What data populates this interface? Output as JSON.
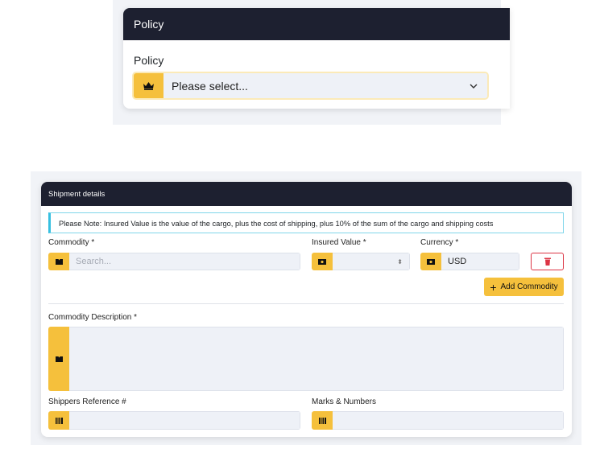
{
  "policy_panel": {
    "header": "Policy",
    "label": "Policy",
    "select_value": "Please select..."
  },
  "shipment": {
    "header": "Shipment details",
    "note": "Please Note: Insured Value is the value of the cargo, plus the cost of shipping, plus 10% of the sum of the cargo and shipping costs",
    "commodity_label": "Commodity *",
    "commodity_placeholder": "Search...",
    "insured_label": "Insured Value *",
    "currency_label": "Currency *",
    "currency_value": "USD",
    "add_commodity": "Add Commodity",
    "description_label": "Commodity Description *",
    "shippers_ref_label": "Shippers Reference #",
    "marks_label": "Marks & Numbers"
  },
  "colors": {
    "accent": "#f5c03c",
    "header": "#1d2030",
    "danger": "#dc3545",
    "info": "#4fc3e0"
  }
}
